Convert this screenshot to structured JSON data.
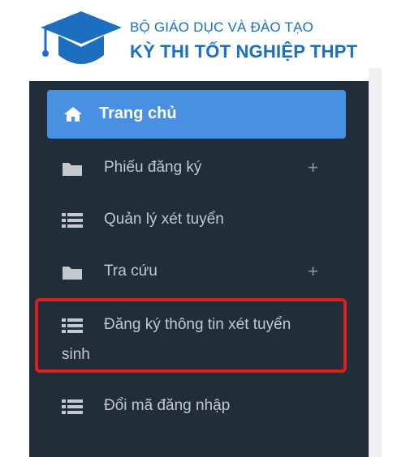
{
  "header": {
    "org_name": "BỘ GIÁO DỤC VÀ ĐÀO TẠO",
    "system_name": "KỲ THI TỐT NGHIỆP THPT",
    "logo_icon": "graduation-cap-icon",
    "brand_color": "#1c6fbf"
  },
  "sidebar": {
    "background": "#222d3a",
    "active_color": "#4a90e2",
    "items": [
      {
        "label": "Trang chủ",
        "icon": "home-icon",
        "active": true
      },
      {
        "label": "Phiếu đăng ký",
        "icon": "folder-icon",
        "expand": "+"
      },
      {
        "label": "Quản lý xét tuyển",
        "icon": "list-icon"
      },
      {
        "label": "Tra cứu",
        "icon": "folder-icon",
        "expand": "+"
      },
      {
        "label_line1": "Đăng ký thông tin xét tuyển",
        "label_line2": "sinh",
        "icon": "list-icon",
        "highlighted": true
      },
      {
        "label": "Đổi mã đăng nhập",
        "icon": "list-icon"
      }
    ]
  }
}
